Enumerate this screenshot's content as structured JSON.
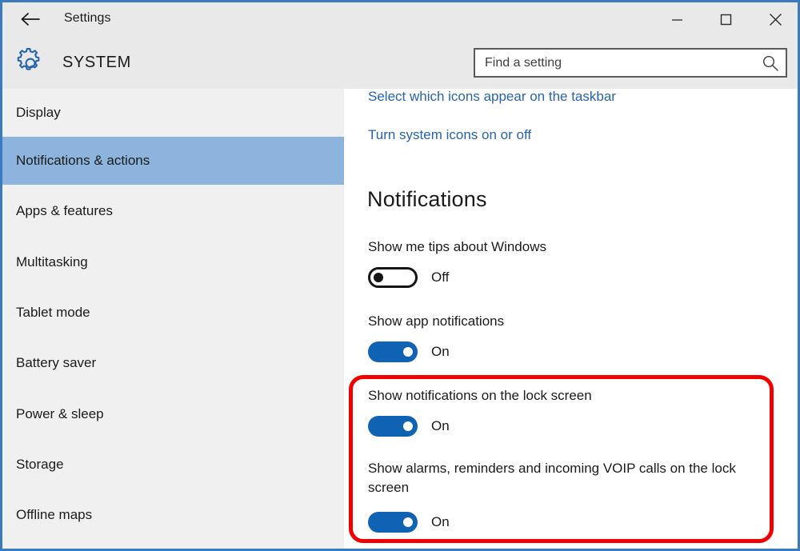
{
  "window": {
    "title": "Settings",
    "border_color": "#3a7bbf",
    "controls": {
      "minimize": "Minimize",
      "maximize": "Maximize",
      "close": "Close"
    },
    "back_label": "Back"
  },
  "header": {
    "section_title": "SYSTEM",
    "gear_icon": "gear-icon",
    "accent_color": "#2764ae"
  },
  "search": {
    "placeholder": "Find a setting",
    "value": "",
    "icon": "search-icon"
  },
  "sidebar": {
    "selected_index": 1,
    "highlight_color": "#8cb4dc",
    "items": [
      {
        "label": "Display"
      },
      {
        "label": "Notifications & actions"
      },
      {
        "label": "Apps & features"
      },
      {
        "label": "Multitasking"
      },
      {
        "label": "Tablet mode"
      },
      {
        "label": "Battery saver"
      },
      {
        "label": "Power & sleep"
      },
      {
        "label": "Storage"
      },
      {
        "label": "Offline maps"
      }
    ]
  },
  "content": {
    "links": [
      {
        "label": "Select which icons appear on the taskbar"
      },
      {
        "label": "Turn system icons on or off"
      }
    ],
    "heading": "Notifications",
    "settings": [
      {
        "label": "Show me tips about Windows",
        "state": "Off",
        "on": false
      },
      {
        "label": "Show app notifications",
        "state": "On",
        "on": true
      },
      {
        "label": "Show notifications on the lock screen",
        "state": "On",
        "on": true
      },
      {
        "label": "Show alarms, reminders and incoming VOIP calls on the lock screen",
        "state": "On",
        "on": true
      }
    ],
    "link_color": "#2764ae",
    "toggle_on_color": "#0f62b4"
  },
  "annotation": {
    "type": "rounded-rectangle",
    "color": "#f20000",
    "surrounds": "lock screen notification settings"
  }
}
